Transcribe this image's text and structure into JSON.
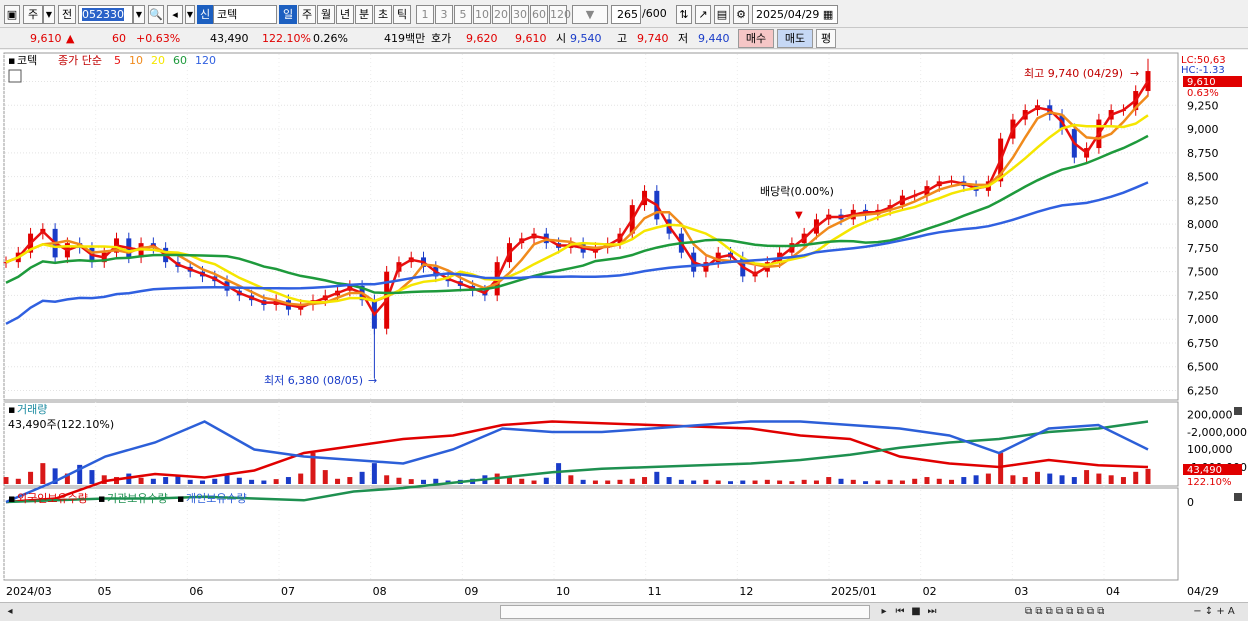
{
  "toolbar": {
    "type_label": "주",
    "prev_label": "전",
    "code": "052330",
    "badge": "신",
    "name": "코텍",
    "periods": [
      "일",
      "주",
      "월",
      "년",
      "분",
      "초",
      "틱"
    ],
    "intervals": [
      "1",
      "3",
      "5",
      "10",
      "20",
      "30",
      "60",
      "120"
    ],
    "count": "265",
    "count_total": "/600",
    "date": "2025/04/29"
  },
  "quote": {
    "price": "9,610",
    "arrow": "▲",
    "change": "60",
    "change_pct": "+0.63%",
    "volume": "43,490",
    "vol_ratio": "122.10%",
    "turnover": "0.26%",
    "amount": "419백만",
    "hoga_label": "호가",
    "ask": "9,620",
    "bid": "9,610",
    "open_label": "시",
    "open": "9,540",
    "high_label": "고",
    "high": "9,740",
    "low_label": "저",
    "low": "9,440",
    "buy_label": "매수",
    "sell_label": "매도",
    "avg_label": "평"
  },
  "legend": {
    "name": "코텍",
    "ma_prefix": "종가 단순",
    "ma": [
      {
        "label": "5",
        "color": "#e81010"
      },
      {
        "label": "10",
        "color": "#f08a1c"
      },
      {
        "label": "20",
        "color": "#f5e600"
      },
      {
        "label": "60",
        "color": "#1e9a3c"
      },
      {
        "label": "120",
        "color": "#3060e0"
      }
    ]
  },
  "price_panel": {
    "lc": "LC:50,63",
    "hc": "HC:-1.33",
    "last": "9,610",
    "last_pct": "0.63%",
    "high_note": "최고 9,740 (04/29)",
    "low_note": "최저 6,380 (08/05)",
    "dividend_note": "배당락(0.00%)"
  },
  "volume_panel": {
    "title": "거래량",
    "info": "43,490주(122.10%)",
    "last": "43,490",
    "last_pct": "122.10%"
  },
  "holdings_panel": {
    "labels": [
      "외국인보유수량",
      "기관보유수량",
      "개인보유수량"
    ],
    "colors": [
      "#e00000",
      "#1e9050",
      "#2c5fd8"
    ]
  },
  "x_labels": [
    "2024/03",
    "05",
    "06",
    "07",
    "08",
    "09",
    "10",
    "11",
    "12",
    "2025/01",
    "02",
    "03",
    "04"
  ],
  "x_last": "04/29",
  "chart_data": [
    {
      "type": "candlestick",
      "title": "코텍",
      "y_ticks": [
        6250,
        6500,
        6750,
        7000,
        7250,
        7500,
        7750,
        8000,
        8250,
        8500,
        8750,
        9000,
        9250,
        9500
      ],
      "ylim": [
        6150,
        9800
      ],
      "x_months": [
        "2024/03",
        "05",
        "06",
        "07",
        "08",
        "09",
        "10",
        "11",
        "12",
        "2025/01",
        "02",
        "03",
        "04"
      ],
      "close_series": [
        7600,
        7700,
        7900,
        7950,
        7650,
        7800,
        7750,
        7600,
        7700,
        7850,
        7650,
        7800,
        7750,
        7600,
        7550,
        7500,
        7450,
        7400,
        7300,
        7250,
        7200,
        7150,
        7200,
        7100,
        7150,
        7200,
        7250,
        7300,
        7350,
        7200,
        6900,
        7500,
        7600,
        7650,
        7550,
        7450,
        7400,
        7350,
        7300,
        7250,
        7600,
        7800,
        7850,
        7900,
        7800,
        7750,
        7800,
        7700,
        7750,
        7800,
        7900,
        8200,
        8350,
        8050,
        7900,
        7700,
        7500,
        7600,
        7700,
        7650,
        7450,
        7500,
        7600,
        7700,
        7800,
        7900,
        8050,
        8100,
        8050,
        8150,
        8100,
        8150,
        8200,
        8300,
        8300,
        8400,
        8450,
        8450,
        8400,
        8350,
        8450,
        8900,
        9100,
        9200,
        9250,
        9150,
        9000,
        8700,
        8800,
        9100,
        9200,
        9200,
        9400,
        9610
      ],
      "ma_lines": [
        "MA5",
        "MA10",
        "MA20",
        "MA60",
        "MA120"
      ],
      "high": {
        "value": 9740,
        "date": "04/29"
      },
      "low": {
        "value": 6380,
        "date": "08/05"
      },
      "last": 9610
    },
    {
      "type": "bar",
      "title": "거래량",
      "y_ticks": [
        100000,
        200000
      ],
      "last": 43490,
      "values": [
        20000,
        15000,
        35000,
        60000,
        45000,
        30000,
        55000,
        40000,
        25000,
        20000,
        30000,
        18000,
        15000,
        20000,
        22000,
        12000,
        10000,
        15000,
        25000,
        18000,
        12000,
        10000,
        14000,
        20000,
        30000,
        90000,
        40000,
        15000,
        20000,
        35000,
        60000,
        25000,
        18000,
        14000,
        12000,
        15000,
        10000,
        12000,
        15000,
        25000,
        30000,
        20000,
        15000,
        10000,
        18000,
        60000,
        25000,
        12000,
        10000,
        10000,
        12000,
        15000,
        20000,
        35000,
        20000,
        12000,
        10000,
        12000,
        10000,
        8000,
        10000,
        10000,
        12000,
        10000,
        8000,
        12000,
        10000,
        20000,
        15000,
        12000,
        8000,
        10000,
        12000,
        10000,
        15000,
        20000,
        15000,
        12000,
        20000,
        25000,
        30000,
        90000,
        25000,
        20000,
        35000,
        30000,
        25000,
        20000,
        40000,
        30000,
        25000,
        20000,
        35000,
        43490
      ]
    },
    {
      "type": "line",
      "series": [
        {
          "name": "외국인보유수량",
          "values": [
            0,
            -100000,
            -600000,
            -800000,
            -700000,
            -900000,
            -1400000,
            -1600000,
            -1800000,
            -1900000,
            -2200000,
            -2300000,
            -2250000,
            -2200000,
            -2150000,
            -2100000,
            -1900000,
            -1800000,
            -1300000,
            -1100000,
            -1000000,
            -1200000,
            -1050000,
            -1000000
          ]
        },
        {
          "name": "기관보유수량",
          "values": [
            0,
            -50000,
            -100000,
            -100000,
            -150000,
            -100000,
            -50000,
            -300000,
            -400000,
            -550000,
            -700000,
            -850000,
            -950000,
            -1000000,
            -1050000,
            -1100000,
            -1200000,
            -1350000,
            -1550000,
            -1700000,
            -1800000,
            -2000000,
            -2100000,
            -2300000
          ]
        },
        {
          "name": "개인보유수량",
          "values": [
            0,
            -600000,
            -1300000,
            -1700000,
            -2300000,
            -1500000,
            -1300000,
            -1200000,
            -1100000,
            -1500000,
            -2100000,
            -2000000,
            -2000000,
            -2100000,
            -2200000,
            -2300000,
            -2300000,
            -2200000,
            -2100000,
            -1900000,
            -1400000,
            -2100000,
            -2200000,
            -1500000
          ]
        }
      ],
      "y_ticks": [
        0,
        -1000000,
        -2000000
      ]
    }
  ]
}
